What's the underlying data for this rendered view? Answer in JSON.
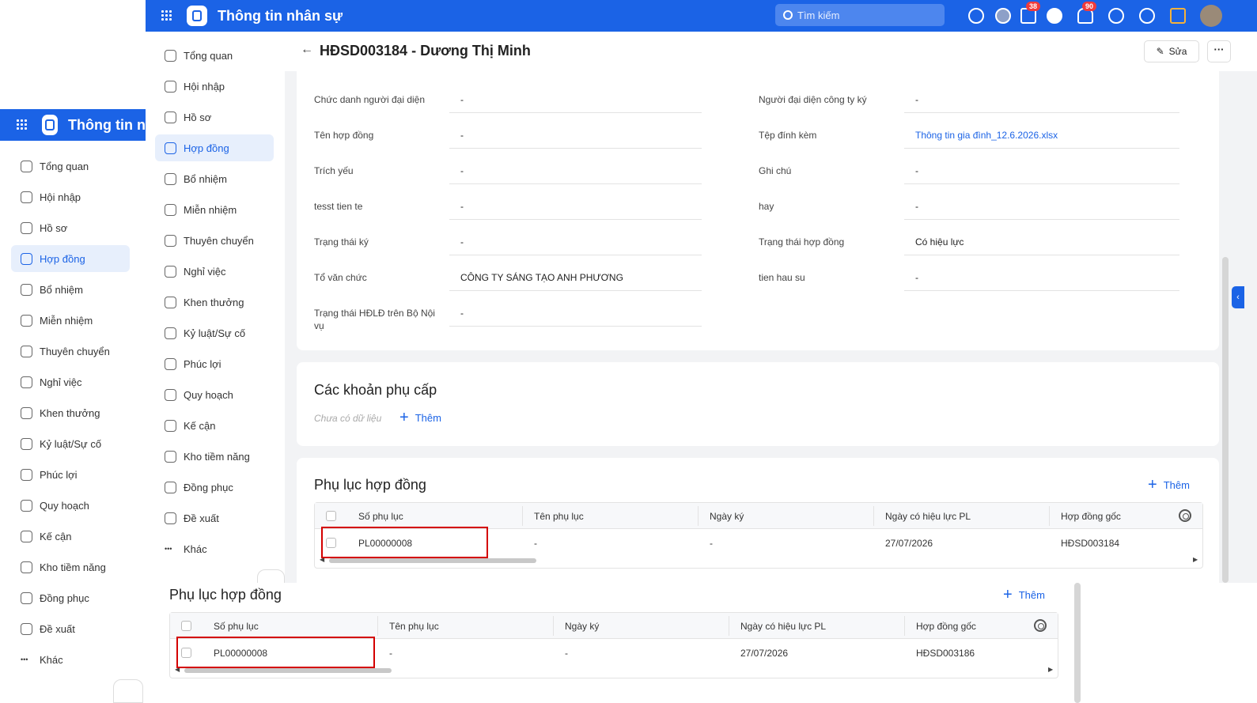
{
  "app": {
    "title": "Thông tin nhân sự",
    "title_short": "Thông tin n",
    "search_placeholder": "Tìm kiếm",
    "badge_announce": "38",
    "badge_notify": "90"
  },
  "nav": [
    "Tổng quan",
    "Hội nhập",
    "Hồ sơ",
    "Hợp đồng",
    "Bổ nhiệm",
    "Miễn nhiệm",
    "Thuyên chuyển",
    "Nghỉ việc",
    "Khen thưởng",
    "Kỷ luật/Sự cố",
    "Phúc lợi",
    "Quy hoạch",
    "Kế cận",
    "Kho tiềm năng",
    "Đồng phục",
    "Đề xuất",
    "Khác"
  ],
  "header": {
    "title": "HĐSD003184 - Dương Thị Minh",
    "edit_label": "Sửa"
  },
  "fields_left": [
    {
      "label": "Chức danh người đại diện",
      "value": "-"
    },
    {
      "label": "Tên hợp đồng",
      "value": "-"
    },
    {
      "label": "Trích yếu",
      "value": "-"
    },
    {
      "label": "tesst tien te",
      "value": "-"
    },
    {
      "label": "Trạng thái ký",
      "value": "-"
    },
    {
      "label": "Tổ văn chức",
      "value": "CÔNG TY SÁNG TẠO ANH PHƯƠNG"
    },
    {
      "label": "Trạng thái HĐLĐ trên Bộ Nội vụ",
      "value": "-"
    }
  ],
  "fields_right": [
    {
      "label": "Người đại diện công ty ký",
      "value": "-"
    },
    {
      "label": "Tệp đính kèm",
      "value": "Thông tin gia đình_12.6.2026.xlsx"
    },
    {
      "label": "Ghi chú",
      "value": "-"
    },
    {
      "label": "hay",
      "value": "-"
    },
    {
      "label": "Trạng thái hợp đồng",
      "value": "Có hiệu lực"
    },
    {
      "label": "tien hau su",
      "value": "-"
    }
  ],
  "allowance": {
    "title": "Các khoản phụ cấp",
    "empty": "Chưa có dữ liệu",
    "add": "Thêm"
  },
  "appendix": {
    "title": "Phụ lục hợp đồng",
    "add": "Thêm",
    "columns": [
      "Số phụ lục",
      "Tên phụ lục",
      "Ngày ký",
      "Ngày có hiệu lực PL",
      "Hợp đồng gốc"
    ],
    "row": [
      "PL00000008",
      "-",
      "-",
      "27/07/2026",
      "HĐSD003184"
    ]
  },
  "appendix2": {
    "title": "Phụ lục hợp đồng",
    "add": "Thêm",
    "columns": [
      "Số phụ lục",
      "Tên phụ lục",
      "Ngày ký",
      "Ngày có hiệu lực PL",
      "Hợp đồng gốc"
    ],
    "row": [
      "PL00000008",
      "-",
      "-",
      "27/07/2026",
      "HĐSD003186"
    ]
  },
  "colors": {
    "primary": "#1b63e6",
    "highlight": "#d40000"
  }
}
